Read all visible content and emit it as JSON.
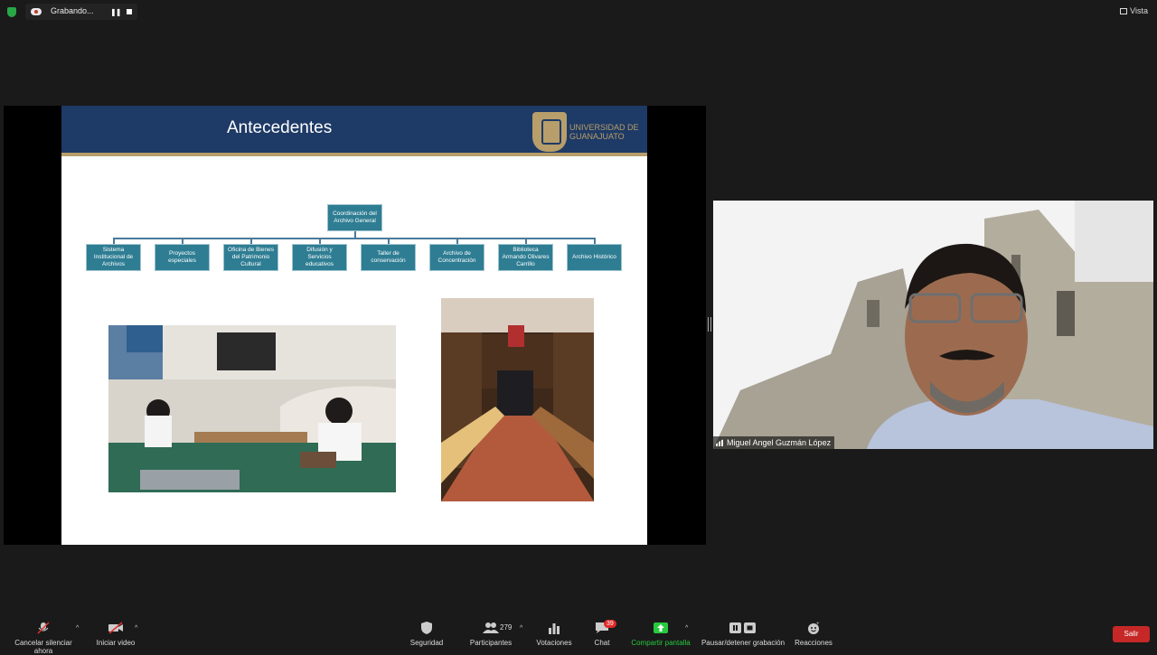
{
  "recording": {
    "label": "Grabando...",
    "pause_icon": "pause-icon",
    "stop_icon": "stop-icon"
  },
  "view": {
    "label": "Vista"
  },
  "slide": {
    "title": "Antecedentes",
    "logo_text": "UNIVERSIDAD DE GUANAJUATO",
    "org_top": "Coordinación del Archivo General",
    "org_children": [
      "Sistema Institucional de Archivos",
      "Proyectos especiales",
      "Oficina de Bienes del Patrimonio Cultural",
      "Difusión y Servicios educativos",
      "Taller de conservación",
      "Archivo de Concentración",
      "Biblioteca Armando Olivares Carrillo",
      "Archivo Histórico"
    ]
  },
  "speaker": {
    "name": "Miguel Angel Guzmán López"
  },
  "toolbar": {
    "mute": "Cancelar silenciar ahora",
    "video": "Iniciar video",
    "security": "Seguridad",
    "participants": "Participantes",
    "participants_count": "279",
    "polls": "Votaciones",
    "chat": "Chat",
    "chat_badge": "39",
    "share": "Compartir pantalla",
    "record": "Pausar/detener grabación",
    "reactions": "Reacciones",
    "leave": "Salir"
  },
  "colors": {
    "accent_green": "#27c93f",
    "leave_red": "#c62828",
    "slide_header": "#1e3a66",
    "org_box": "#2e7d93"
  }
}
